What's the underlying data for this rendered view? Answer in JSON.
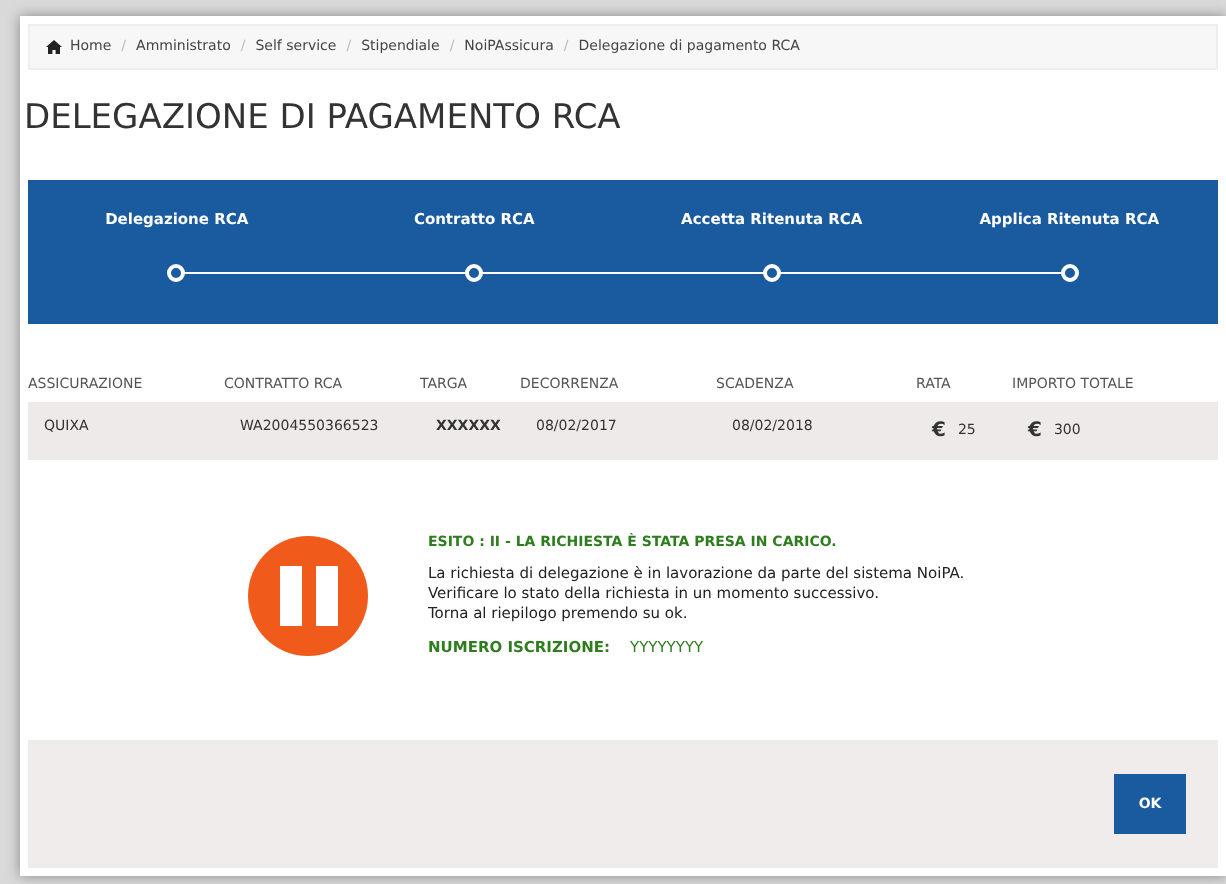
{
  "breadcrumb_separator": "/",
  "breadcrumb": [
    {
      "label": "Home",
      "kind": "home"
    },
    {
      "label": "Amministrato",
      "kind": "link"
    },
    {
      "label": "Self service",
      "kind": "link"
    },
    {
      "label": "Stipendiale",
      "kind": "link"
    },
    {
      "label": "NoiPAssicura",
      "kind": "link"
    },
    {
      "label": "Delegazione di pagamento RCA",
      "kind": "current"
    }
  ],
  "title": "DELEGAZIONE DI PAGAMENTO RCA",
  "steps": [
    "Delegazione RCA",
    "Contratto RCA",
    "Accetta Ritenuta RCA",
    "Applica Ritenuta RCA"
  ],
  "table": {
    "columns": [
      "ASSICURAZIONE",
      "CONTRATTO RCA",
      "TARGA",
      "DECORRENZA",
      "SCADENZA",
      "RATA",
      "IMPORTO TOTALE"
    ],
    "rows": [
      [
        {
          "text": "QUIXA",
          "kind": "text"
        },
        {
          "text": "WA2004550366523",
          "kind": "text"
        },
        {
          "text": "XXXXXX",
          "kind": "bold"
        },
        {
          "text": "08/02/2017",
          "kind": "text"
        },
        {
          "text": "08/02/2018",
          "kind": "text"
        },
        {
          "symbol": "€",
          "text": "25",
          "kind": "money"
        },
        {
          "symbol": "€",
          "text": "300",
          "kind": "money"
        }
      ]
    ]
  },
  "result": {
    "heading": "ESITO : II - LA RICHIESTA È STATA PRESA IN CARICO.",
    "lines": [
      "La richiesta di delegazione è in lavorazione da parte del sistema NoiPA.",
      "Verificare lo stato della richiesta in un momento successivo.",
      "Torna al riepilogo premendo su ok."
    ],
    "number_label": "NUMERO ISCRIZIONE:",
    "number_value": "YYYYYYYY"
  },
  "buttons": [
    "OK"
  ]
}
